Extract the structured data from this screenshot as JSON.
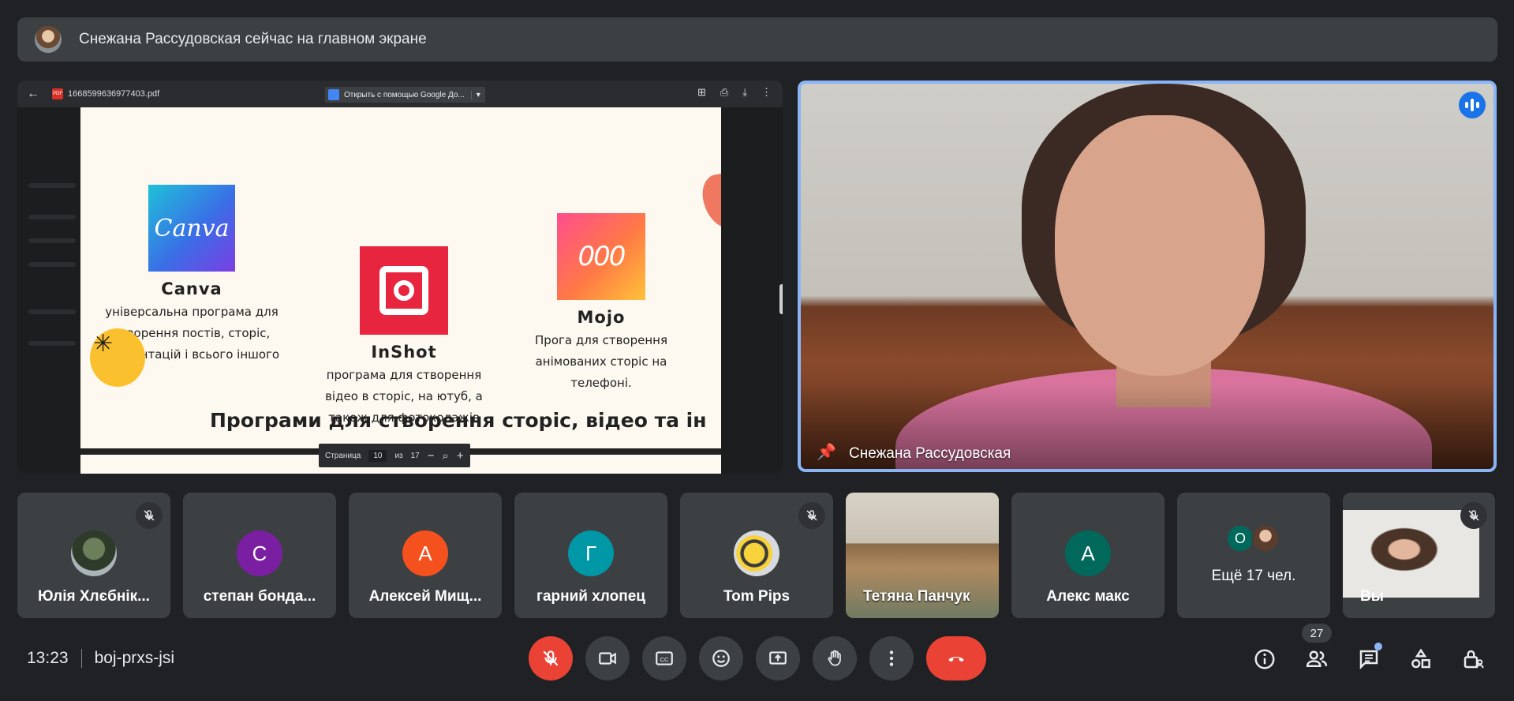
{
  "banner": {
    "text": "Снежана Рассудовская сейчас на главном экране"
  },
  "share": {
    "filename": "1668599636977403.pdf",
    "open_with": "Открыть с помощью Google До...",
    "page_label": "Страница",
    "page_current": "10",
    "page_of": "из",
    "page_total": "17",
    "apps": [
      {
        "name": "Canva",
        "logo_text": "Canva",
        "desc_lines": [
          "універсальна програма для",
          "створення постів, сторіс,",
          "презентацій і всього іншого"
        ]
      },
      {
        "name": "InShot",
        "desc_lines": [
          "програма для створення",
          "відео в сторіс, на ютуб, а",
          "також для фотоколажів"
        ]
      },
      {
        "name": "Mojo",
        "logo_text": "000",
        "desc_lines": [
          "Прога для створення",
          "анімованих сторіс на",
          "телефоні."
        ]
      }
    ],
    "slide_title": "Програми для створення сторіс, відео та ін"
  },
  "main_tile": {
    "name": "Снежана Рассудовская",
    "border_color": "#8ab4f8"
  },
  "participants": [
    {
      "name": "Юлія Хлєбнік...",
      "muted": true,
      "avatar": "photo"
    },
    {
      "name": "степан бонда...",
      "initial": "С",
      "color": "#7b1fa2"
    },
    {
      "name": "Алексей Мищ...",
      "initial": "А",
      "color": "#f4511e"
    },
    {
      "name": "гарний хлопец",
      "initial": "Г",
      "color": "#0097a7"
    },
    {
      "name": "Tom Pips",
      "muted": true,
      "avatar": "bee"
    },
    {
      "name": "Тетяна Панчук",
      "video": true
    },
    {
      "name": "Алекс макс",
      "initial": "А",
      "color": "#00695c"
    },
    {
      "name": "Ещё 17 чел.",
      "initial": "О"
    },
    {
      "name": "Вы",
      "muted": true,
      "video": true
    }
  ],
  "controls": {
    "time": "13:23",
    "meeting_code": "boj-prxs-jsi",
    "people_count": "27",
    "end_color": "#ea4335"
  }
}
